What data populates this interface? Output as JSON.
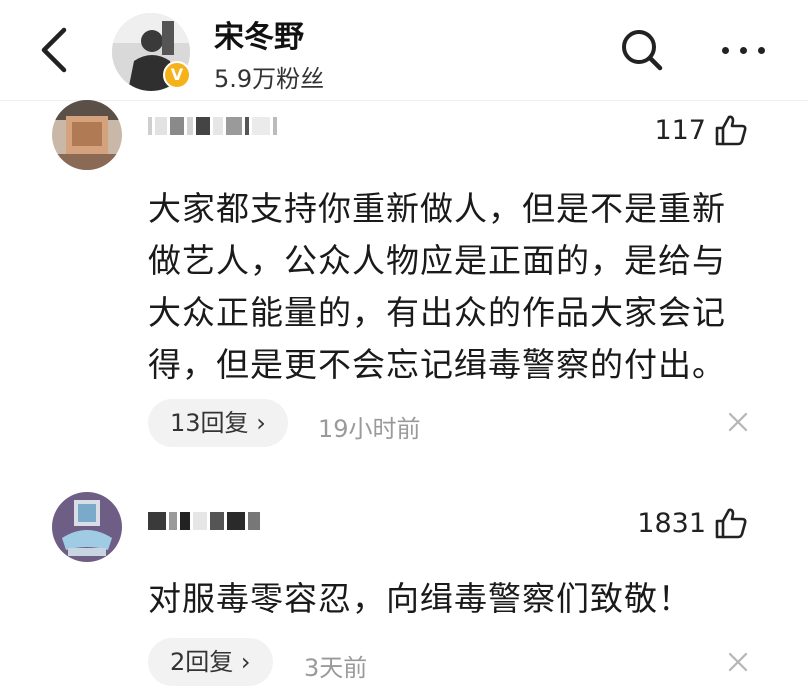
{
  "header": {
    "name": "宋冬野",
    "followers": "5.9万粉丝",
    "verify_mark": "V",
    "icons": [
      "back-arrow-icon",
      "verified-badge-icon",
      "search-icon",
      "more-icon"
    ]
  },
  "comments": [
    {
      "likes": "117",
      "text": "大家都支持你重新做人，但是不是重新做艺人，公众人物应是正面的，是给与大众正能量的，有出众的作品大家会记得，但是更不会忘记缉毒警察的付出。",
      "replies": "13回复",
      "reply_chevron": "›",
      "time": "19小时前"
    },
    {
      "likes": "1831",
      "text": "对服毒零容忍，向缉毒警察们致敬！",
      "replies": "2回复",
      "reply_chevron": "›",
      "time": "3天前"
    }
  ],
  "colors": {
    "badge": "#f6b21a",
    "pill_bg": "#f2f2f2",
    "muted_text": "#9a9a9a",
    "divider": "#eeeeee"
  }
}
